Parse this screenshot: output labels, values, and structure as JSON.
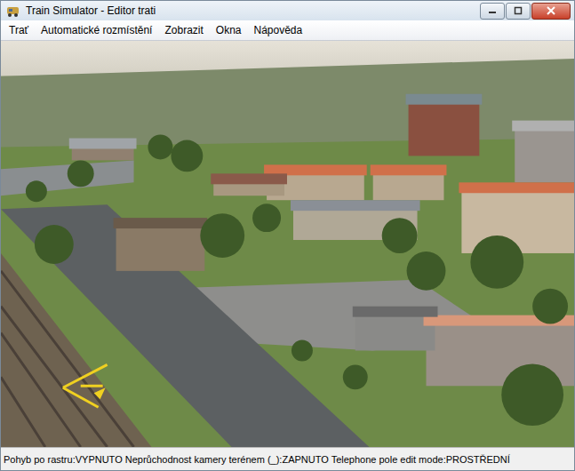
{
  "window": {
    "title": "Train Simulator - Editor trati"
  },
  "menu": [
    {
      "label": "Trať"
    },
    {
      "label": "Automatické rozmístění"
    },
    {
      "label": "Zobrazit"
    },
    {
      "label": "Okna"
    },
    {
      "label": "Nápověda"
    }
  ],
  "status_bar": {
    "text": "Pohyb po rastru:VYPNUTO Neprůchodnost kamery terénem (_):ZAPNUTO Telephone pole edit mode:PROSTŘEDNÍ"
  }
}
